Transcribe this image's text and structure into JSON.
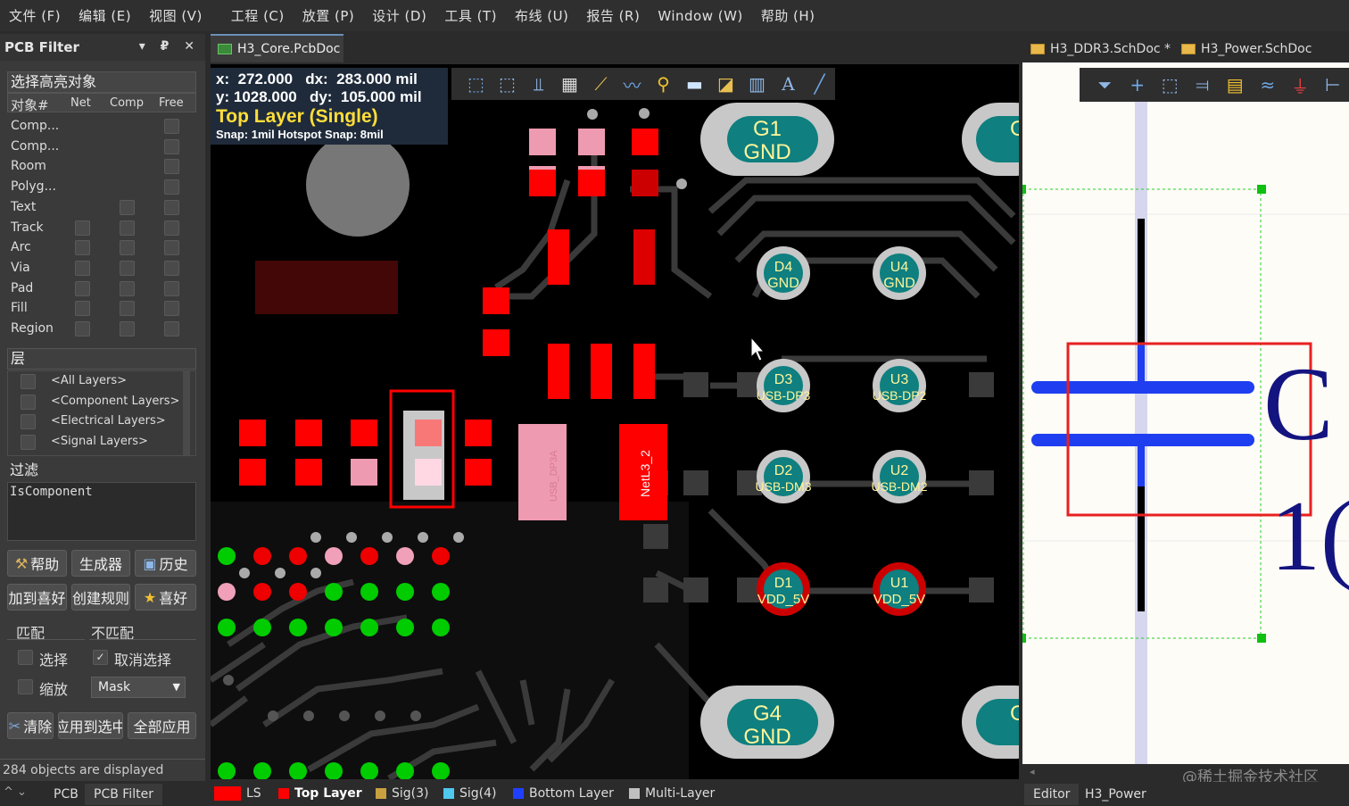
{
  "menu": [
    "文件 (F)",
    "编辑 (E)",
    "视图 (V)",
    "工程 (C)",
    "放置 (P)",
    "设计 (D)",
    "工具 (T)",
    "布线 (U)",
    "报告 (R)",
    "Window (W)",
    "帮助 (H)"
  ],
  "filter_panel": {
    "title": "PCB Filter",
    "title_icons": "▾ ₽ ✕",
    "highlight_section": "选择高亮对象",
    "columns": [
      "对象#",
      "Net",
      "Comp",
      "Free"
    ],
    "objects": [
      "Comp...",
      "Comp...",
      "Room",
      "Polyg...",
      "Text",
      "Track",
      "Arc",
      "Via",
      "Pad",
      "Fill",
      "Region"
    ],
    "layers_section": "层",
    "layers": [
      "<All Layers>",
      "<Component Layers>",
      "<Electrical Layers>",
      "<Signal Layers>"
    ],
    "filter_section": "过滤",
    "filter_query": "IsComponent",
    "buttons_row1": [
      "帮助",
      "生成器",
      "历史"
    ],
    "buttons_row2": [
      "加到喜好",
      "创建规则",
      "喜好"
    ],
    "match_label": "匹配",
    "nomatch_label": "不匹配",
    "select_label": "选择",
    "deselect_label": "取消选择",
    "zoom_label": "缩放",
    "mask_value": "Mask",
    "buttons_row3": [
      "清除",
      "应用到选中",
      "全部应用"
    ],
    "status": "284 objects are displayed"
  },
  "doc_tab": "H3_Core.PcbDoc",
  "right_tabs": [
    "H3_DDR3.SchDoc *",
    "H3_Power.SchDoc"
  ],
  "coords": {
    "x_label": "x:",
    "x": "272.000",
    "dx_label": "dx:",
    "dx": "283.000 mil",
    "y_label": "y:",
    "y": "1028.000",
    "dy_label": "dy:",
    "dy": "105.000 mil",
    "layer": "Top Layer (Single)",
    "snap": "Snap: 1mil Hotspot Snap: 8mil"
  },
  "pcb_labels": {
    "g1": [
      "G1",
      "GND"
    ],
    "g4": [
      "G4",
      "GND"
    ],
    "d4": [
      "D4",
      "GND"
    ],
    "u4": [
      "U4",
      "GND"
    ],
    "d3": [
      "D3",
      "USB-DP3"
    ],
    "u3": [
      "U3",
      "USB-DP2"
    ],
    "d2": [
      "D2",
      "USB-DM3"
    ],
    "u2": [
      "U2",
      "USB-DM2"
    ],
    "d1": [
      "D1",
      "VDD_5V"
    ],
    "u1": [
      "U1",
      "VDD_5V"
    ],
    "net_label": "NetL3_2",
    "ghost_label": "USB_DP3A",
    "partial_c": "G",
    "partial_c2": "G"
  },
  "schematic": {
    "designator": "C",
    "value": "1("
  },
  "bottom_layers": [
    {
      "name": "LS",
      "color": "#ff0000"
    },
    {
      "name": "Top Layer",
      "color": "#ff0000"
    },
    {
      "name": "Sig(3)",
      "color": "#c8a040"
    },
    {
      "name": "Sig(4)",
      "color": "#4fc8f0"
    },
    {
      "name": "Bottom Layer",
      "color": "#2040ff"
    },
    {
      "name": "Multi-Layer",
      "color": "#c0c0c0"
    }
  ],
  "bottom_left_tabs": [
    "PCB",
    "PCB Filter"
  ],
  "bottom_right_tabs": [
    "Editor",
    "H3_Power"
  ],
  "watermark": "@稀土掘金技术社区"
}
